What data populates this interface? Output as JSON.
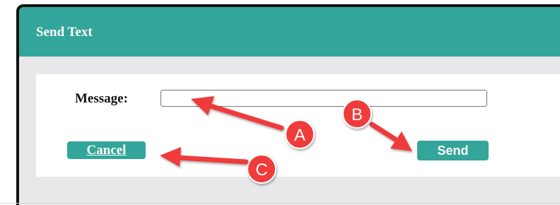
{
  "window": {
    "title": "Send Text"
  },
  "form": {
    "message_label": "Message:",
    "message_value": "",
    "message_placeholder": ""
  },
  "buttons": {
    "cancel_label": "Cancel",
    "send_label": "Send"
  },
  "annotations": [
    {
      "label": "A",
      "points_to": "message-input"
    },
    {
      "label": "B",
      "points_to": "send-button"
    },
    {
      "label": "C",
      "points_to": "cancel-button"
    }
  ],
  "colors": {
    "titlebar": "#33a59a",
    "button": "#33a59a",
    "annotation": "#ef3b3b",
    "frame": "#111111",
    "background": "#e8e8ea"
  }
}
